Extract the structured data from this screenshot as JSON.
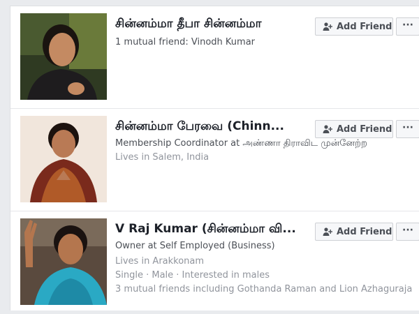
{
  "colors": {
    "page_bg": "#e9ebee",
    "card_bg": "#ffffff",
    "name_text": "#1d2129",
    "secondary_text": "#4b4f56",
    "muted_text": "#90949c",
    "button_bg": "#f6f7f9",
    "button_border": "#ced0d4"
  },
  "icons": {
    "add_friend": "add-friend-icon",
    "more": "more-options-icon"
  },
  "results": [
    {
      "name": "சின்னம்மா தீபா சின்னம்மா",
      "lines": [
        "1 mutual friend: Vinodh Kumar"
      ],
      "add_label": "Add Friend",
      "more_label": "···"
    },
    {
      "name": "சின்னம்மா பேரவை (Chinn...",
      "lines": [
        "Membership Coordinator at அண்ணா திராவிட முன்னேற்ற",
        "Lives in Salem, India"
      ],
      "add_label": "Add Friend",
      "more_label": "···"
    },
    {
      "name": "V Raj Kumar (சின்னம்மா வி...",
      "lines": [
        "Owner at Self Employed (Business)",
        "Lives in Arakkonam",
        "Single · Male · Interested in males",
        "3 mutual friends including Gothanda Raman and Lion Azhaguraja"
      ],
      "add_label": "Add Friend",
      "more_label": "···"
    }
  ]
}
